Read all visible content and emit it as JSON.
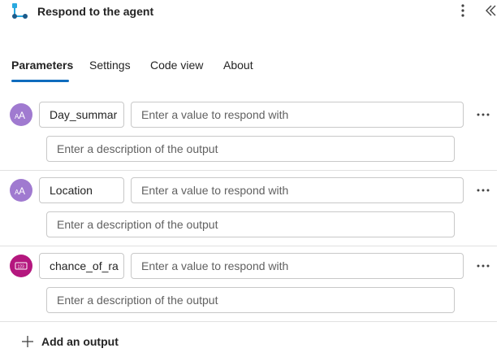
{
  "header": {
    "title": "Respond to the agent",
    "icon": "flow-connector-icon",
    "accent_color": "#29a9e0"
  },
  "tabs": [
    {
      "label": "Parameters",
      "active": true
    },
    {
      "label": "Settings",
      "active": false
    },
    {
      "label": "Code view",
      "active": false
    },
    {
      "label": "About",
      "active": false
    }
  ],
  "outputs": [
    {
      "type_icon": "text-type-icon",
      "type_color": "#a07ad0",
      "name": "Day_summar",
      "value_placeholder": "Enter a value to respond with",
      "description_placeholder": "Enter a description of the output"
    },
    {
      "type_icon": "text-type-icon",
      "type_color": "#a07ad0",
      "name": "Location",
      "value_placeholder": "Enter a value to respond with",
      "description_placeholder": "Enter a description of the output"
    },
    {
      "type_icon": "number-type-icon",
      "type_color": "#b4177e",
      "name": "chance_of_ra",
      "value_placeholder": "Enter a value to respond with",
      "description_placeholder": "Enter a description of the output"
    }
  ],
  "add_output_label": "Add an output"
}
